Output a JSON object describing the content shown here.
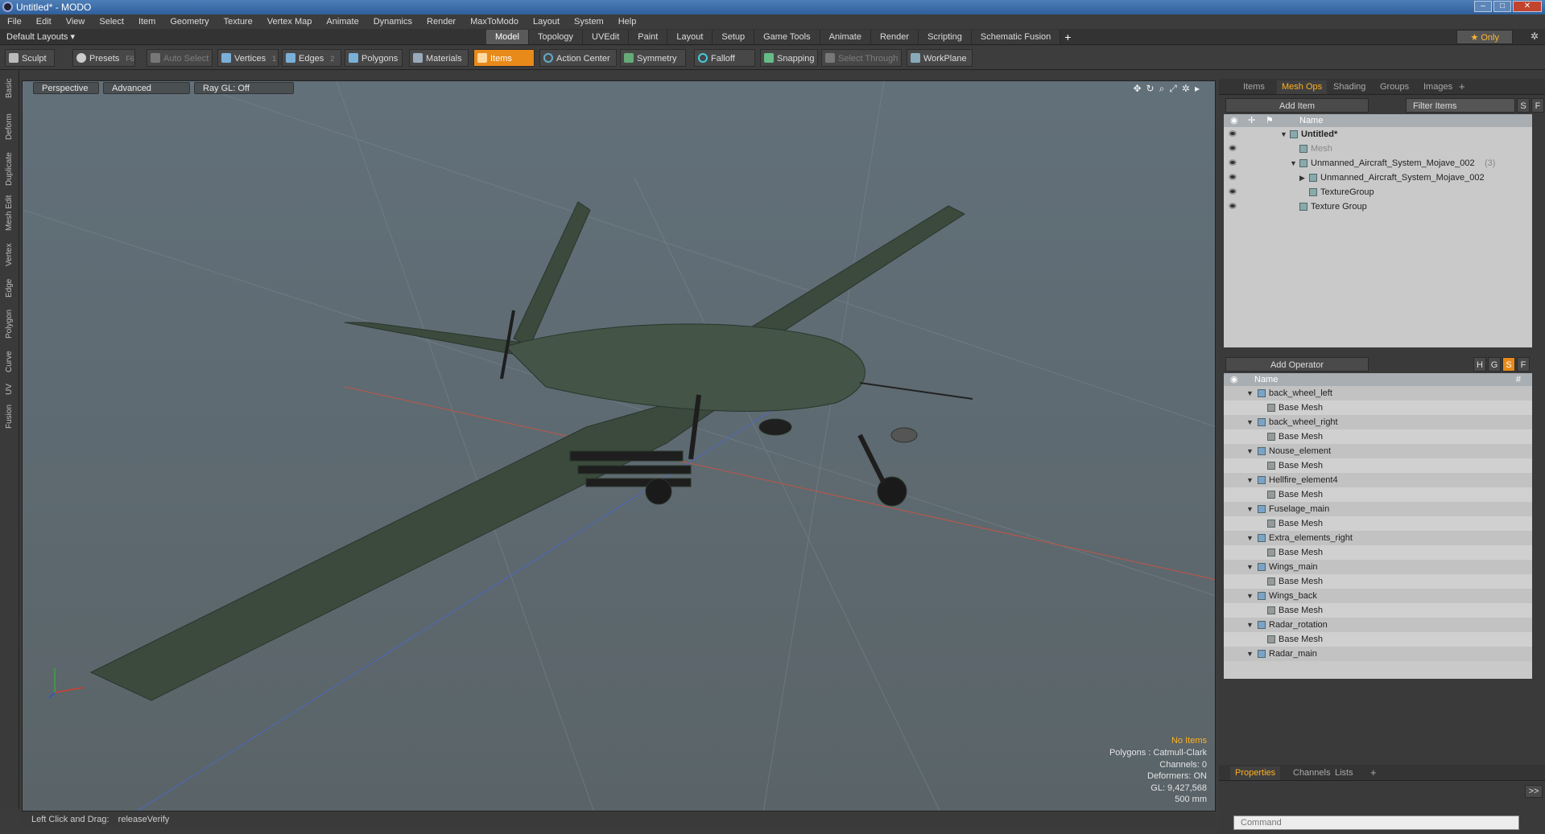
{
  "window": {
    "title": "Untitled* - MODO"
  },
  "menu": [
    "File",
    "Edit",
    "View",
    "Select",
    "Item",
    "Geometry",
    "Texture",
    "Vertex Map",
    "Animate",
    "Dynamics",
    "Render",
    "MaxToModo",
    "Layout",
    "System",
    "Help"
  ],
  "layout_selector": "Default Layouts ▾",
  "layout_tabs": [
    {
      "label": "Model",
      "active": true
    },
    {
      "label": "Topology"
    },
    {
      "label": "UVEdit"
    },
    {
      "label": "Paint"
    },
    {
      "label": "Layout"
    },
    {
      "label": "Setup"
    },
    {
      "label": "Game Tools"
    },
    {
      "label": "Animate"
    },
    {
      "label": "Render"
    },
    {
      "label": "Scripting"
    },
    {
      "label": "Schematic Fusion"
    }
  ],
  "only_label": "★  Only",
  "toolbar": {
    "sculpt": "Sculpt",
    "presets": "Presets",
    "presets_key": "F6",
    "auto_select": "Auto Select",
    "vertices": "Vertices",
    "vertices_key": "1",
    "edges": "Edges",
    "edges_key": "2",
    "polygons": "Polygons",
    "materials": "Materials",
    "items": "Items",
    "action_center": "Action Center",
    "symmetry": "Symmetry",
    "falloff": "Falloff",
    "snapping": "Snapping",
    "select_through": "Select Through",
    "workplane": "WorkPlane"
  },
  "left_tabs": [
    "Basic",
    "Deform",
    "Duplicate",
    "Mesh Edit",
    "Vertex",
    "Edge",
    "Polygon",
    "Curve",
    "UV",
    "Fusion"
  ],
  "viewport": {
    "view": "Perspective",
    "advanced": "Advanced",
    "raygl": "Ray GL: Off",
    "stats": {
      "items": "No Items",
      "polygons": "Polygons : Catmull-Clark",
      "channels": "Channels: 0",
      "deformers": "Deformers: ON",
      "gl": "GL: 9,427,568",
      "scale": "500 mm"
    }
  },
  "status": {
    "label": "Left Click and Drag:",
    "value": "releaseVerify"
  },
  "item_panel": {
    "tabs": [
      "Items",
      "Mesh Ops",
      "Shading",
      "Groups",
      "Images"
    ],
    "active_tab": "Mesh Ops",
    "add_item": "Add Item",
    "filter": "Filter Items",
    "s_btn": "S",
    "f_btn": "F",
    "name_header": "Name",
    "tree": [
      {
        "label": "Untitled*",
        "indent": 0,
        "bold": true
      },
      {
        "label": "Mesh",
        "indent": 1,
        "dim": true
      },
      {
        "label": "Unmanned_Aircraft_System_Mojave_002",
        "suffix": "(3)",
        "indent": 1
      },
      {
        "label": "Unmanned_Aircraft_System_Mojave_002",
        "indent": 2
      },
      {
        "label": "TextureGroup",
        "indent": 2
      },
      {
        "label": "Texture Group",
        "indent": 1
      }
    ]
  },
  "operator_panel": {
    "add_operator": "Add Operator",
    "flags": [
      "H",
      "G",
      "S",
      "F"
    ],
    "name_header": "Name",
    "hash_header": "#",
    "items": [
      {
        "name": "back_wheel_left",
        "child": "Base Mesh"
      },
      {
        "name": "back_wheel_right",
        "child": "Base Mesh"
      },
      {
        "name": "Nouse_element",
        "child": "Base Mesh"
      },
      {
        "name": "Hellfire_element4",
        "child": "Base Mesh"
      },
      {
        "name": "Fuselage_main",
        "child": "Base Mesh"
      },
      {
        "name": "Extra_elements_right",
        "child": "Base Mesh"
      },
      {
        "name": "Wings_main",
        "child": "Base Mesh"
      },
      {
        "name": "Wings_back",
        "child": "Base Mesh"
      },
      {
        "name": "Radar_rotation",
        "child": "Base Mesh"
      },
      {
        "name": "Radar_main",
        "child": ""
      }
    ]
  },
  "properties_panel": {
    "tabs": [
      "Properties",
      "Channels",
      "Lists"
    ],
    "active_tab": "Properties",
    "more": ">>"
  },
  "command": {
    "placeholder": "Command"
  },
  "colors": {
    "accent": "#e88a1a",
    "viewport_bg": "#5e6a6f",
    "aircraft": "#3a4a3c"
  }
}
